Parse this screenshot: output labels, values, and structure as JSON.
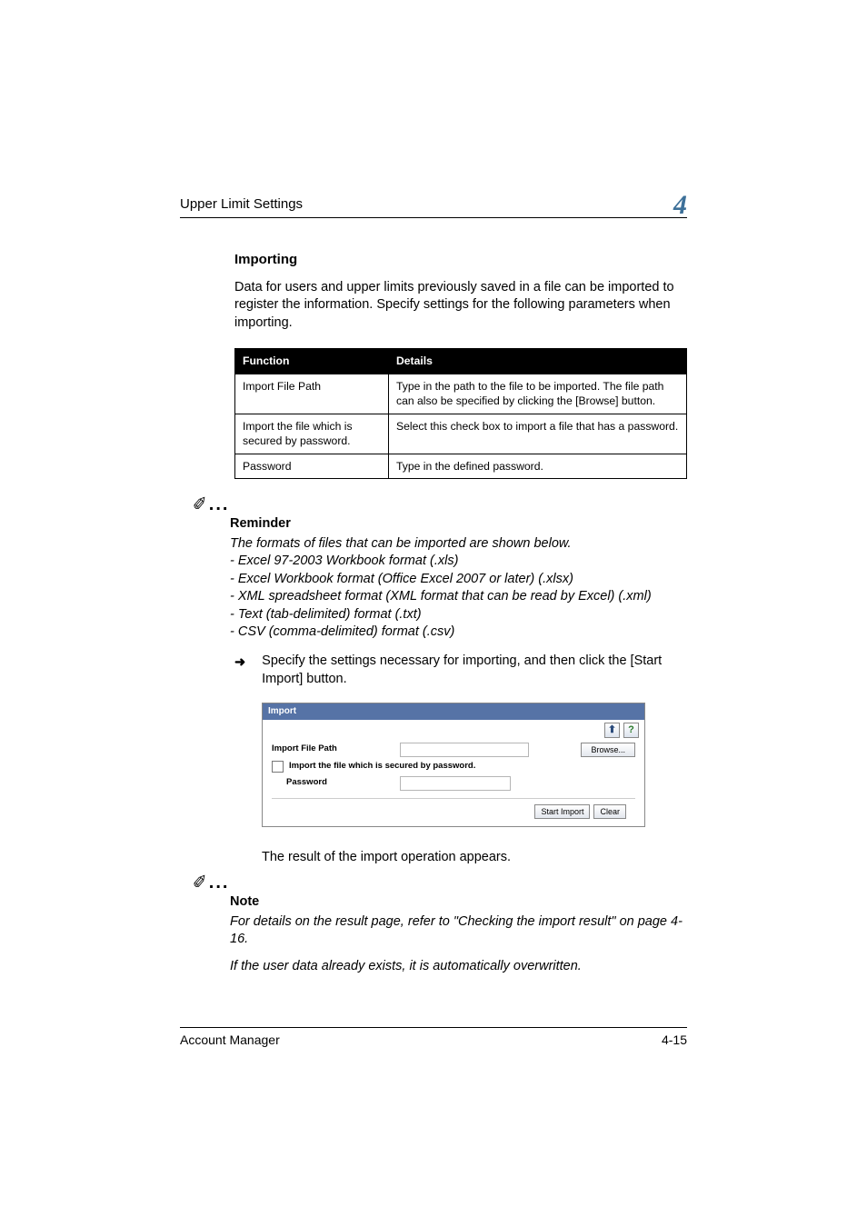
{
  "header": {
    "running_title": "Upper Limit Settings",
    "chapter_number": "4"
  },
  "section": {
    "heading": "Importing",
    "intro": "Data for users and upper limits previously saved in a file can be imported to register the information. Specify settings for the following parameters when importing."
  },
  "table": {
    "headers": {
      "func": "Function",
      "details": "Details"
    },
    "rows": [
      {
        "func": "Import File Path",
        "details": "Type in the path to the file to be imported. The file path can also be specified by clicking the [Browse] button."
      },
      {
        "func": "Import the file which is secured by password.",
        "details": "Select this check box to import a file that has a password."
      },
      {
        "func": "Password",
        "details": "Type in the defined password."
      }
    ]
  },
  "reminder": {
    "label": "Reminder",
    "intro": "The formats of files that can be imported are shown below.",
    "lines": [
      "- Excel 97-2003 Workbook format (.xls)",
      "- Excel Workbook format (Office Excel 2007 or later) (.xlsx)",
      "- XML spreadsheet format (XML format that can be read by Excel) (.xml)",
      "- Text (tab-delimited) format (.txt)",
      "- CSV (comma-delimited) format (.csv)"
    ]
  },
  "step": {
    "arrow": "➜",
    "text": "Specify the settings necessary for importing, and then click the [Start Import] button."
  },
  "screenshot": {
    "title": "Import",
    "toolbar": {
      "to_top": "⬆",
      "help": "?"
    },
    "labels": {
      "path": "Import File Path",
      "secured": "Import the file which is secured by password.",
      "password": "Password"
    },
    "buttons": {
      "browse": "Browse...",
      "start": "Start Import",
      "clear": "Clear"
    }
  },
  "result_line": "The result of the import operation appears.",
  "note": {
    "label": "Note",
    "p1": "For details on the result page, refer to \"Checking the import result\" on page 4-16.",
    "p2": "If the user data already exists, it is automatically overwritten."
  },
  "footer": {
    "product": "Account Manager",
    "page": "4-15"
  }
}
